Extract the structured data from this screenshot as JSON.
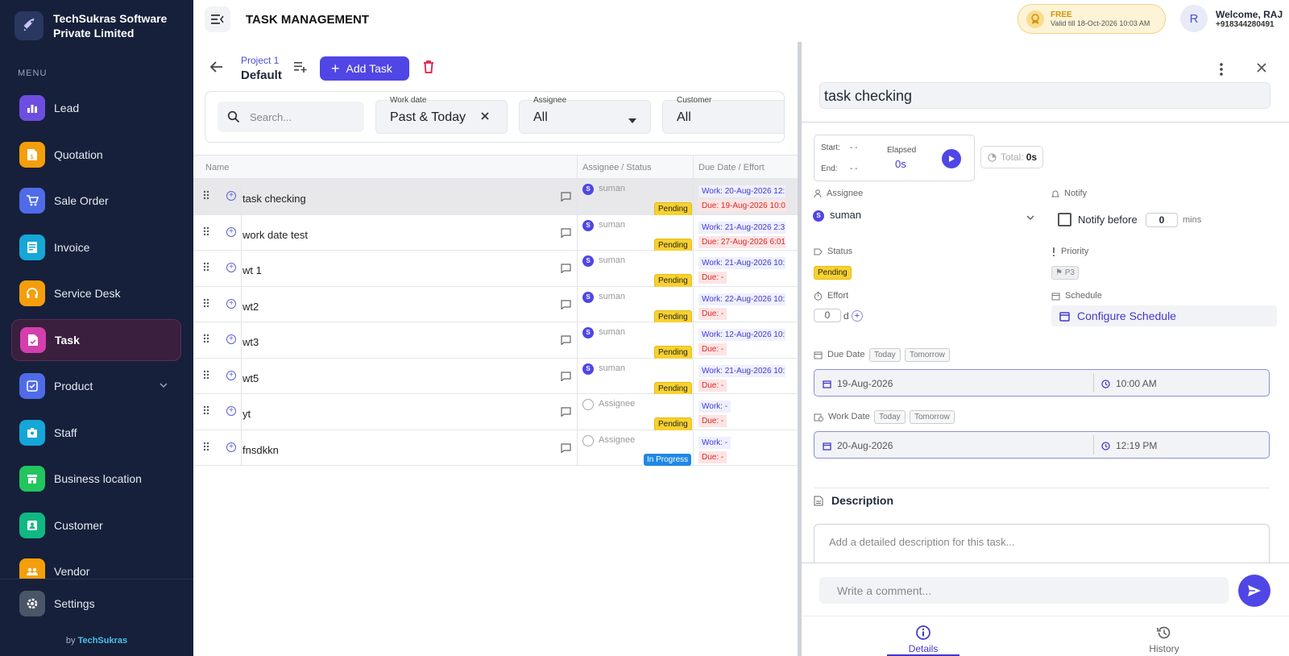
{
  "brand": {
    "name": "TechSukras Software Private Limited"
  },
  "sidebar": {
    "menu_title": "MENU",
    "items": [
      {
        "label": "Lead",
        "icon": "chart-icon",
        "color": "#6d4ee0"
      },
      {
        "label": "Quotation",
        "icon": "quote-icon",
        "color": "#f59e0b"
      },
      {
        "label": "Sale Order",
        "icon": "cart-icon",
        "color": "#4f6be8"
      },
      {
        "label": "Invoice",
        "icon": "invoice-icon",
        "color": "#14a7d7"
      },
      {
        "label": "Service Desk",
        "icon": "headset-icon",
        "color": "#f59e0b"
      },
      {
        "label": "Task",
        "icon": "task-icon",
        "color": "#d43fae"
      },
      {
        "label": "Product",
        "icon": "product-icon",
        "color": "#4f6be8"
      },
      {
        "label": "Staff",
        "icon": "staff-icon",
        "color": "#14a7d7"
      },
      {
        "label": "Business location",
        "icon": "store-icon",
        "color": "#22c55e"
      },
      {
        "label": "Customer",
        "icon": "customer-icon",
        "color": "#10b981"
      },
      {
        "label": "Vendor",
        "icon": "vendor-icon",
        "color": "#f59e0b"
      }
    ],
    "settings": "Settings",
    "by": "by",
    "by_brand": "TechSukras"
  },
  "header": {
    "title": "TASK MANAGEMENT",
    "plan": {
      "name": "FREE",
      "valid": "Valid till 18-Oct-2026 10:03 AM"
    },
    "user": {
      "initial": "R",
      "welcome": "Welcome, RAJ",
      "phone": "+918344280491"
    }
  },
  "project": {
    "label": "Project 1",
    "name": "Default",
    "add_task": "Add Task"
  },
  "filters": {
    "search_placeholder": "Search...",
    "work_date": {
      "label": "Work date",
      "value": "Past & Today"
    },
    "assignee": {
      "label": "Assignee",
      "value": "All"
    },
    "customer": {
      "label": "Customer",
      "value": "All"
    }
  },
  "table": {
    "columns": [
      "Name",
      "Assignee / Status",
      "Due Date / Effort"
    ],
    "rows": [
      {
        "name": "task checking",
        "assignee": "suman",
        "status": "Pending",
        "work": "Work: 20-Aug-2026 12:",
        "due": "Due: 19-Aug-2026 10:0"
      },
      {
        "name": "work date test",
        "assignee": "suman",
        "status": "Pending",
        "work": "Work: 21-Aug-2026 2:3",
        "due": "Due: 27-Aug-2026 6:01"
      },
      {
        "name": "wt 1",
        "assignee": "suman",
        "status": "Pending",
        "work": "Work: 21-Aug-2026 10:",
        "due": "Due: -"
      },
      {
        "name": "wt2",
        "assignee": "suman",
        "status": "Pending",
        "work": "Work: 22-Aug-2026 10:",
        "due": "Due: -"
      },
      {
        "name": "wt3",
        "assignee": "suman",
        "status": "Pending",
        "work": "Work: 12-Aug-2026 10:",
        "due": "Due: -"
      },
      {
        "name": "wt5",
        "assignee": "suman",
        "status": "Pending",
        "work": "Work: 21-Aug-2026 10:",
        "due": "Due: -"
      },
      {
        "name": "yt",
        "assignee": "Assignee",
        "status": "Pending",
        "work": "Work: -",
        "due": "Due: -"
      },
      {
        "name": "fnsdkkn",
        "assignee": "Assignee",
        "status": "In Progress",
        "work": "Work: -",
        "due": "Due: -"
      }
    ]
  },
  "detail": {
    "title": "task checking",
    "timer": {
      "start_label": "Start:",
      "start_val": "-  -",
      "end_label": "End:",
      "end_val": "-  -",
      "elapsed_label": "Elapsed",
      "elapsed_val": "0s",
      "total_label": "Total:",
      "total_val": "0s"
    },
    "assignee": {
      "label": "Assignee",
      "initial": "S",
      "value": "suman"
    },
    "notify": {
      "label": "Notify",
      "text": "Notify before",
      "value": "0",
      "unit": "mins"
    },
    "status": {
      "label": "Status",
      "value": "Pending"
    },
    "priority": {
      "label": "Priority",
      "value": "P3"
    },
    "effort": {
      "label": "Effort",
      "value": "0",
      "unit": "d"
    },
    "schedule": {
      "label": "Schedule",
      "button": "Configure Schedule"
    },
    "due_date": {
      "label": "Due Date",
      "today": "Today",
      "tomorrow": "Tomorrow",
      "date": "19-Aug-2026",
      "time": "10:00 AM"
    },
    "work_date": {
      "label": "Work Date",
      "today": "Today",
      "tomorrow": "Tomorrow",
      "date": "20-Aug-2026",
      "time": "12:19 PM"
    },
    "description": {
      "label": "Description",
      "placeholder": "Add a detailed description for this task..."
    },
    "comment_placeholder": "Write a comment...",
    "tabs": [
      "Details",
      "History"
    ]
  }
}
